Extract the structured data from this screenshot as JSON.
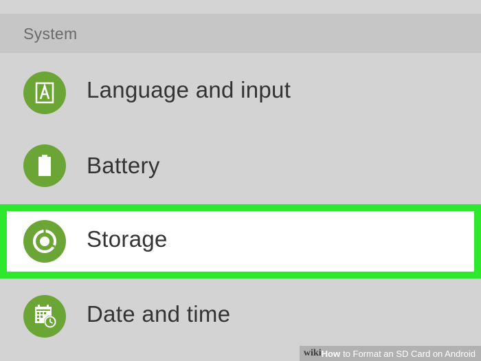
{
  "section": {
    "title": "System"
  },
  "items": [
    {
      "label": "Language and input",
      "icon": "language-icon"
    },
    {
      "label": "Battery",
      "icon": "battery-icon"
    },
    {
      "label": "Storage",
      "icon": "storage-icon",
      "highlighted": true
    },
    {
      "label": "Date and time",
      "icon": "calendar-clock-icon"
    }
  ],
  "watermark": {
    "brand": "wiki",
    "how": "How",
    "rest": "to Format an SD Card on Android"
  },
  "colors": {
    "background": "#d3d3d3",
    "section_header": "#c6c6c6",
    "icon_green": "#6aa536",
    "highlight_border": "#2ee82e",
    "highlight_fill": "#ffffff",
    "text": "#333333"
  }
}
